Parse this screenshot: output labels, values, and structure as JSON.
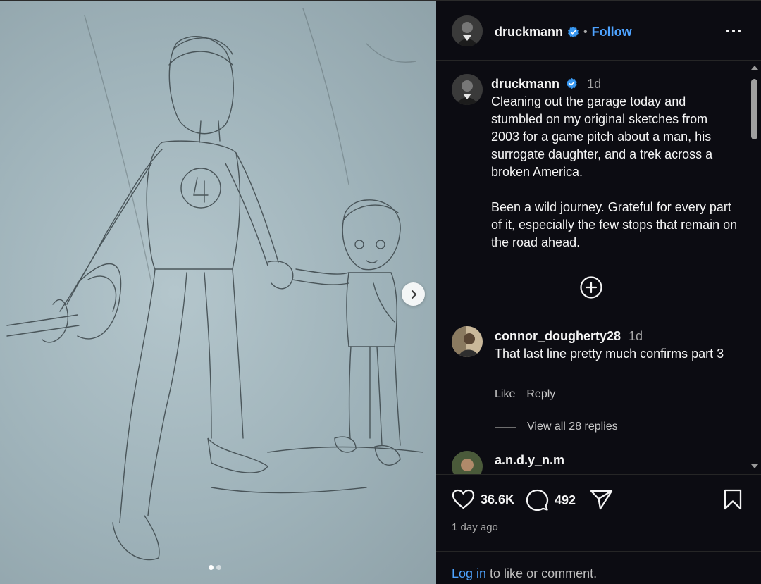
{
  "post": {
    "author": "druckmann",
    "follow_label": "Follow",
    "separator": "•",
    "caption_time": "1d",
    "caption_text": "Cleaning out the garage today and stumbled on my original sketches from 2003 for a game pitch about a man, his surrogate daughter, and a trek across a broken America.\n\nBeen a wild journey. Grateful for every part of it, especially the few stops that remain on the road ahead.",
    "likes": "36.6K",
    "comments_count": "492",
    "date": "1 day ago",
    "carousel": {
      "current": 1,
      "total": 2
    }
  },
  "comments": [
    {
      "user": "connor_dougherty28",
      "time": "1d",
      "text": "That last line pretty much confirms part 3",
      "like_label": "Like",
      "reply_label": "Reply",
      "view_replies": "View all 28 replies"
    },
    {
      "user": "a.n.d.y_n.m"
    }
  ],
  "footer": {
    "login_link": "Log in",
    "login_suffix": " to like or comment."
  },
  "icons": {
    "verified": "verified-badge-icon",
    "like": "heart-icon",
    "comment": "comment-bubble-icon",
    "share": "paper-plane-icon",
    "save": "bookmark-icon",
    "more": "more-options-icon",
    "next": "chevron-right-icon",
    "load_more": "plus-circle-icon"
  },
  "colors": {
    "link": "#4ea3ff",
    "verified": "#3897f0",
    "panel_bg": "#0c0c12"
  }
}
